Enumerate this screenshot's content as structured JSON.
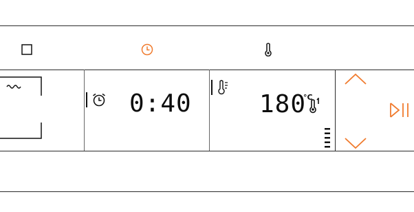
{
  "top_bar": {
    "icons": [
      {
        "name": "oven-mode-square-icon",
        "color": "#111111"
      },
      {
        "name": "clock-icon",
        "color": "#f07b2e"
      },
      {
        "name": "thermometer-icon",
        "color": "#111111"
      }
    ]
  },
  "display": {
    "mode_panel": {
      "icon": "top-heat-wave-icon"
    },
    "timer_panel": {
      "icon": "alarm-clock-icon",
      "time": "0:40"
    },
    "temperature_panel": {
      "icon": "thermometer-steam-icon",
      "temperature": "180",
      "unit": "°C",
      "status_icon": "thermometer-heating-icon",
      "heat_level_bars": 5
    }
  },
  "controls": {
    "up_icon": "chevron-up-icon",
    "down_icon": "chevron-down-icon",
    "play_pause_icon": "play-pause-icon",
    "accent_color": "#f07b2e"
  }
}
